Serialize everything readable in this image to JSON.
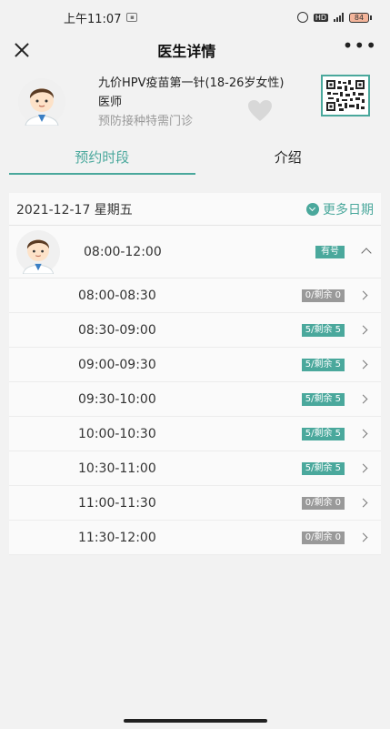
{
  "status_bar": {
    "time": "上午11:07",
    "battery": "84"
  },
  "nav": {
    "title": "医生详情",
    "more": "•••"
  },
  "doctor": {
    "title": "九价HPV疫苗第一针(18-26岁女性)",
    "role": "医师",
    "department": "预防接种特需门诊"
  },
  "tabs": [
    {
      "label": "预约时段",
      "active": true
    },
    {
      "label": "介绍",
      "active": false
    }
  ],
  "schedule": {
    "date": "2021-12-17 星期五",
    "more_dates": "更多日期",
    "session": {
      "time": "08:00-12:00",
      "status": "有号"
    },
    "slots": [
      {
        "time": "08:00-08:30",
        "remaining": "0/剩余 0",
        "available": false
      },
      {
        "time": "08:30-09:00",
        "remaining": "5/剩余 5",
        "available": true
      },
      {
        "time": "09:00-09:30",
        "remaining": "5/剩余 5",
        "available": true
      },
      {
        "time": "09:30-10:00",
        "remaining": "5/剩余 5",
        "available": true
      },
      {
        "time": "10:00-10:30",
        "remaining": "5/剩余 5",
        "available": true
      },
      {
        "time": "10:30-11:00",
        "remaining": "5/剩余 5",
        "available": true
      },
      {
        "time": "11:00-11:30",
        "remaining": "0/剩余 0",
        "available": false
      },
      {
        "time": "11:30-12:00",
        "remaining": "0/剩余 0",
        "available": false
      }
    ]
  },
  "colors": {
    "accent": "#4aa89c",
    "full": "#999999"
  }
}
